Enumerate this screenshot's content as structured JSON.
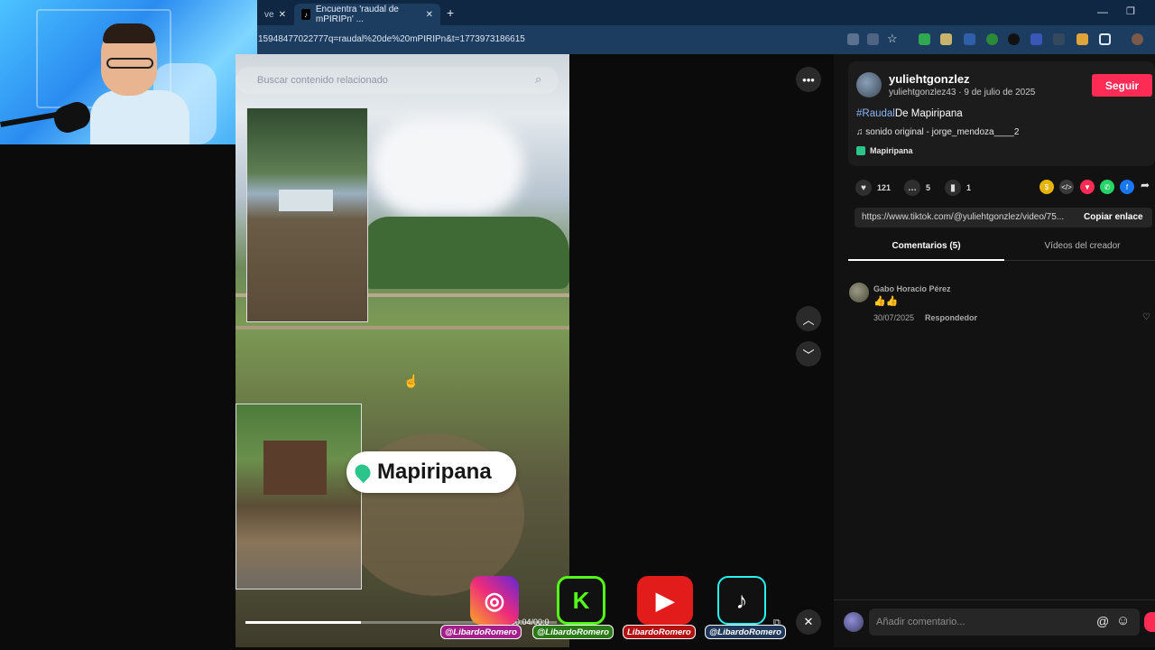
{
  "browser": {
    "tab_prev_label": "ve",
    "tab_active_label": "Encuentra 'raudal de mPIRIPn' ...",
    "url": "15948477022777q=raudal%20de%20mPIRIPn&t=1773973186615"
  },
  "video": {
    "search_placeholder": "Buscar contenido relacionado",
    "location_sticker": "Mapiripana",
    "progress": 0.37,
    "time": "00:04/00:0"
  },
  "post": {
    "username": "yuliehtgonzlez",
    "meta": "yuliehtgonzlez43 · 9 de julio de 2025",
    "follow_label": "Seguir",
    "caption_tag": "#Raudal",
    "caption_rest": "De Mapiripana",
    "sound": "sonido original - jorge_mendoza____2",
    "location": "Mapiripana",
    "likes": "121",
    "comments": "5",
    "saves": "1",
    "link": "https://www.tiktok.com/@yuliehtgonzlez/video/75...",
    "copy_label": "Copiar enlace"
  },
  "tabs": {
    "comments": "Comentarios (5)",
    "creator_videos": "Vídeos del creador"
  },
  "comment": {
    "user": "Gabo Horacio Pérez",
    "text": "👍👍",
    "date": "30/07/2025",
    "reply": "Respondedor"
  },
  "comment_input": {
    "placeholder": "Añadir comentario..."
  },
  "overlay": {
    "ig_handle": "@LibardoRomero",
    "kick_handle": "@LibardoRomero",
    "yt_handle": "LibardoRomero",
    "tt_handle": "@LibardoRomero"
  },
  "colors": {
    "accent": "#fe2c55",
    "hashtag": "#8ab4f8",
    "location_green": "#2bc48a"
  }
}
